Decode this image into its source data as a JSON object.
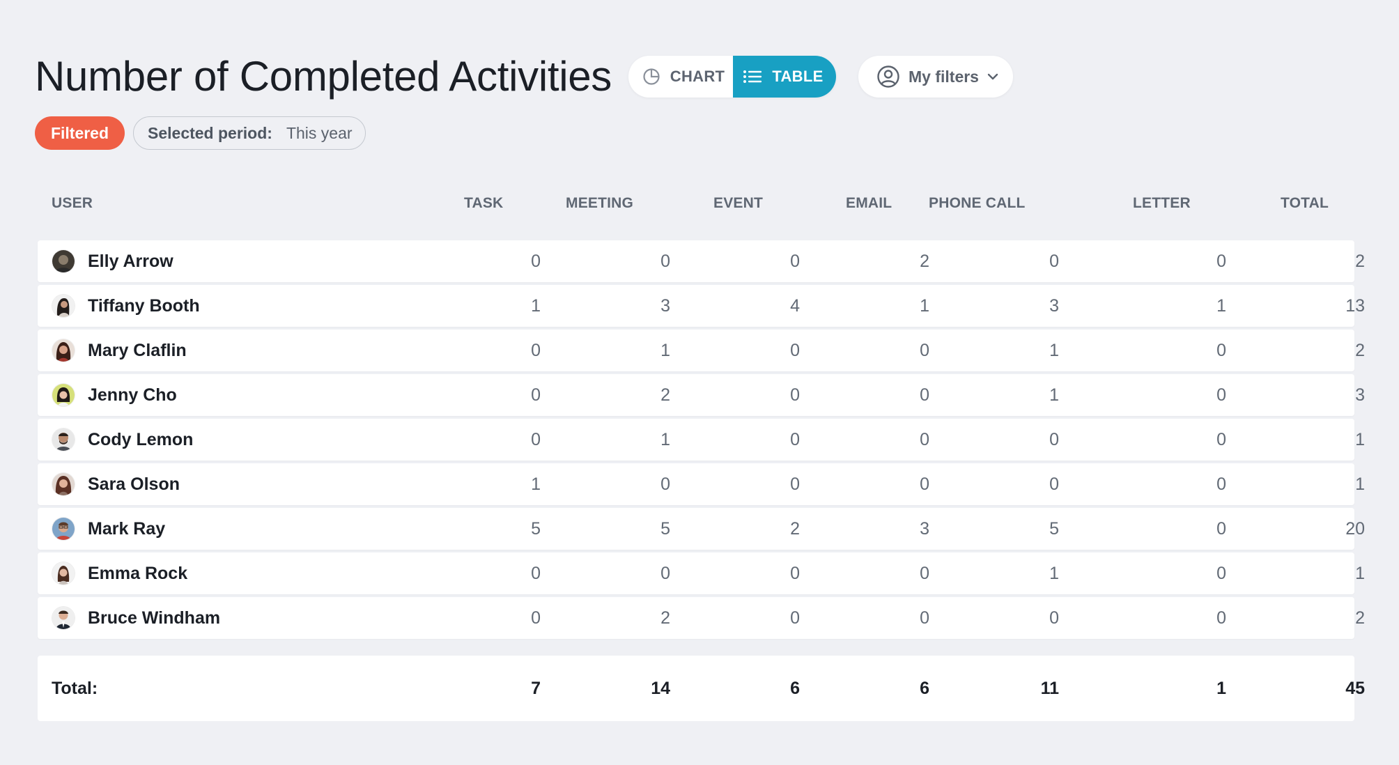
{
  "header": {
    "title": "Number of Completed Activities",
    "chart_label": "CHART",
    "table_label": "TABLE",
    "filters_label": "My filters",
    "badge": "Filtered",
    "period_label": "Selected period:",
    "period_value": "This year"
  },
  "colors": {
    "accent": "#18a0c3",
    "badge": "#ef5f45",
    "background": "#eff0f4"
  },
  "columns": [
    "USER",
    "TASK",
    "MEETING",
    "EVENT",
    "EMAIL",
    "PHONE CALL",
    "LETTER",
    "TOTAL"
  ],
  "rows": [
    {
      "name": "Elly Arrow",
      "values": [
        "0",
        "0",
        "0",
        "2",
        "0",
        "0",
        "2"
      ]
    },
    {
      "name": "Tiffany Booth",
      "values": [
        "1",
        "3",
        "4",
        "1",
        "3",
        "1",
        "13"
      ]
    },
    {
      "name": "Mary Claflin",
      "values": [
        "0",
        "1",
        "0",
        "0",
        "1",
        "0",
        "2"
      ]
    },
    {
      "name": "Jenny Cho",
      "values": [
        "0",
        "2",
        "0",
        "0",
        "1",
        "0",
        "3"
      ]
    },
    {
      "name": "Cody Lemon",
      "values": [
        "0",
        "1",
        "0",
        "0",
        "0",
        "0",
        "1"
      ]
    },
    {
      "name": "Sara Olson",
      "values": [
        "1",
        "0",
        "0",
        "0",
        "0",
        "0",
        "1"
      ]
    },
    {
      "name": "Mark Ray",
      "values": [
        "5",
        "5",
        "2",
        "3",
        "5",
        "0",
        "20"
      ]
    },
    {
      "name": "Emma Rock",
      "values": [
        "0",
        "0",
        "0",
        "0",
        "1",
        "0",
        "1"
      ]
    },
    {
      "name": "Bruce Windham",
      "values": [
        "0",
        "2",
        "0",
        "0",
        "0",
        "0",
        "2"
      ]
    }
  ],
  "totals": {
    "label": "Total:",
    "values": [
      "7",
      "14",
      "6",
      "6",
      "11",
      "1",
      "45"
    ]
  }
}
